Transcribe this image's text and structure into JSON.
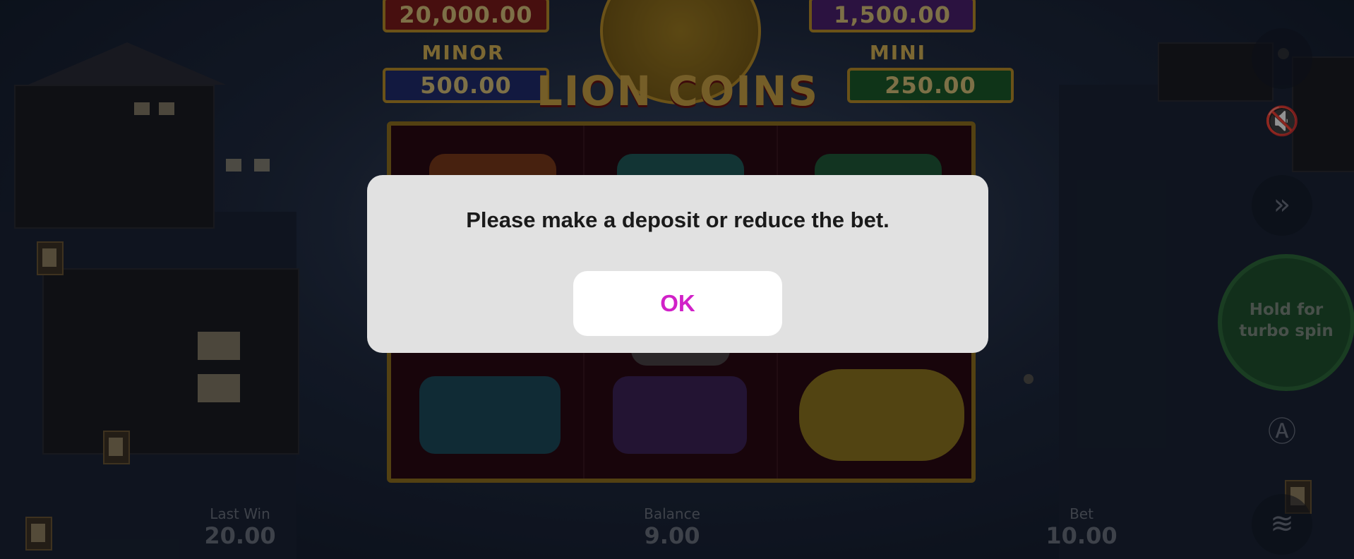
{
  "jackpots": {
    "grand_value": "20,000.00",
    "major_value": "1,500.00",
    "minor_label": "MINOR",
    "minor_value": "500.00",
    "mini_label": "MINI",
    "mini_value": "250.00"
  },
  "game": {
    "title": "LION COINS"
  },
  "controls": {
    "spin_hint": "Hold for\nturbo spin"
  },
  "stats": {
    "last_win_label": "Last Win",
    "last_win_value": "20.00",
    "balance_label": "Balance",
    "balance_value": "9.00",
    "bet_label": "Bet",
    "bet_value": "10.00"
  },
  "dialog": {
    "message": "Please make a deposit or reduce the bet.",
    "ok_label": "OK"
  },
  "colors": {
    "ok_text": "#d121c8",
    "dialog_bg": "#e1e1e1",
    "spin_green": "#1f5230"
  },
  "icons": [
    "sound-muted-icon",
    "fast-forward-icon",
    "autoplay-icon",
    "coins-stack-icon"
  ]
}
